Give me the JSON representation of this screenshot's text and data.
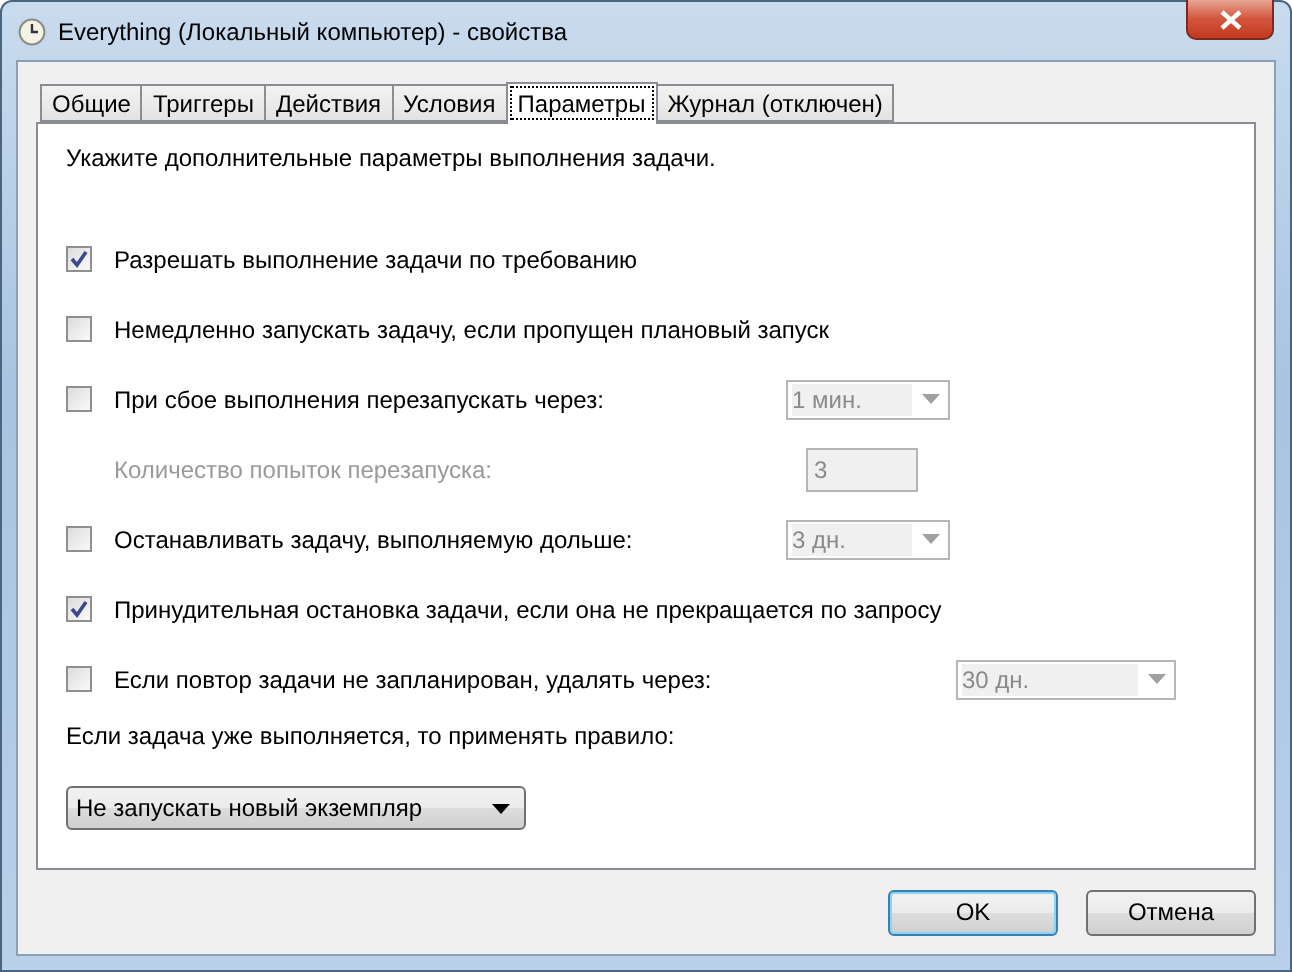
{
  "window": {
    "title": "Everything (Локальный компьютер) - свойства"
  },
  "tabs": [
    {
      "label": "Общие",
      "selected": false
    },
    {
      "label": "Триггеры",
      "selected": false
    },
    {
      "label": "Действия",
      "selected": false
    },
    {
      "label": "Условия",
      "selected": false
    },
    {
      "label": "Параметры",
      "selected": true
    },
    {
      "label": "Журнал (отключен)",
      "selected": false
    }
  ],
  "intro": "Укажите дополнительные параметры выполнения задачи.",
  "options": [
    {
      "kind": "checkbox",
      "label": "Разрешать выполнение задачи по требованию",
      "checked": true
    },
    {
      "kind": "checkbox",
      "label": "Немедленно запускать задачу, если пропущен плановый запуск",
      "checked": false
    },
    {
      "kind": "checkbox",
      "label": "При сбое выполнения перезапускать через:",
      "checked": false,
      "control": {
        "kind": "combo",
        "value": "1 мин.",
        "disabled": true
      }
    },
    {
      "kind": "indented",
      "label": "Количество попыток перезапуска:",
      "disabled": true,
      "control": {
        "kind": "number",
        "value": "3",
        "disabled": true
      }
    },
    {
      "kind": "checkbox",
      "label": "Останавливать задачу, выполняемую дольше:",
      "checked": false,
      "control": {
        "kind": "combo",
        "value": "3 дн.",
        "disabled": true
      }
    },
    {
      "kind": "checkbox",
      "label": "Принудительная остановка задачи, если она не прекращается по запросу",
      "checked": true
    },
    {
      "kind": "checkbox",
      "label": "Если повтор задачи не запланирован, удалять через:",
      "checked": false,
      "control": {
        "kind": "widecombo",
        "value": "30 дн.",
        "disabled": true
      }
    }
  ],
  "rule_label": "Если задача уже выполняется, то применять правило:",
  "rule_select": {
    "value": "Не запускать новый экземпляр"
  },
  "buttons": [
    {
      "label": "OK",
      "default": true
    },
    {
      "label": "Отмена",
      "default": false
    }
  ]
}
